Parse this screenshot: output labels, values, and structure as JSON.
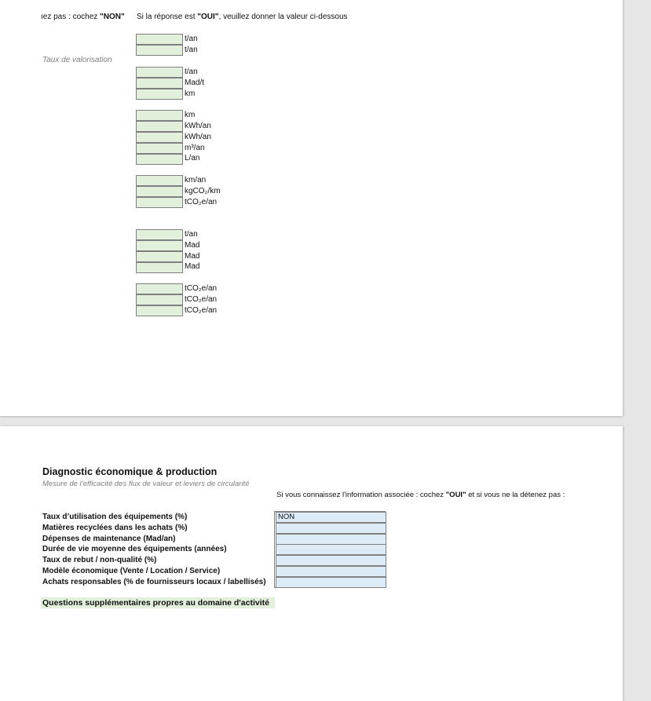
{
  "page1": {
    "instruction_left_prefix": "ıez pas : cochez ",
    "instruction_left_bold": "\"NON\"",
    "instruction_right_prefix": "Si la réponse est ",
    "instruction_right_bold": "\"OUI\"",
    "instruction_right_suffix": ", veuillez donner la valeur ci-dessous",
    "taux_label": "Taux de valorisation",
    "units": [
      "t/an",
      "t/an",
      "t/an",
      "Mad/t",
      "km",
      "km",
      "kWh/an",
      "kWh/an",
      "m³/an",
      "L/an",
      "km/an",
      "kgCO₂/km",
      "tCO₂e/an",
      "t/an",
      "Mad",
      "Mad",
      "Mad",
      "tCO₂e/an",
      "tCO₂e/an",
      "tCO₂e/an"
    ]
  },
  "page2": {
    "section_title": "Diagnostic économique & production",
    "section_subtitle": "Mesure de l’efficacité des flux de valeur et leviers de circularité",
    "instruction_prefix": "Si vous connaissez l'information associée : cochez ",
    "instruction_bold": "\"OUI\"",
    "instruction_suffix": " et si vous ne la détenez pas :",
    "rows": [
      {
        "label": "Taux d’utilisation des équipements (%)",
        "value": "NON"
      },
      {
        "label": "Matières recyclées dans les achats (%)",
        "value": ""
      },
      {
        "label": "Dépenses de maintenance (Mad/an)",
        "value": ""
      },
      {
        "label": "Durée de vie moyenne des équipements (années)",
        "value": ""
      },
      {
        "label": "Taux de rebut / non-qualité (%)",
        "value": ""
      },
      {
        "label": "Modèle économique (Vente / Location / Service)",
        "value": ""
      },
      {
        "label": "Achats responsables (% de fournisseurs locaux / labellisés)",
        "value": ""
      }
    ],
    "supplementary": "Questions supplémentaires propres au domaine d'activité"
  },
  "colors": {
    "green_input": "#e2efda",
    "blue_input": "#ddebf7",
    "background": "#e6e6e6"
  }
}
